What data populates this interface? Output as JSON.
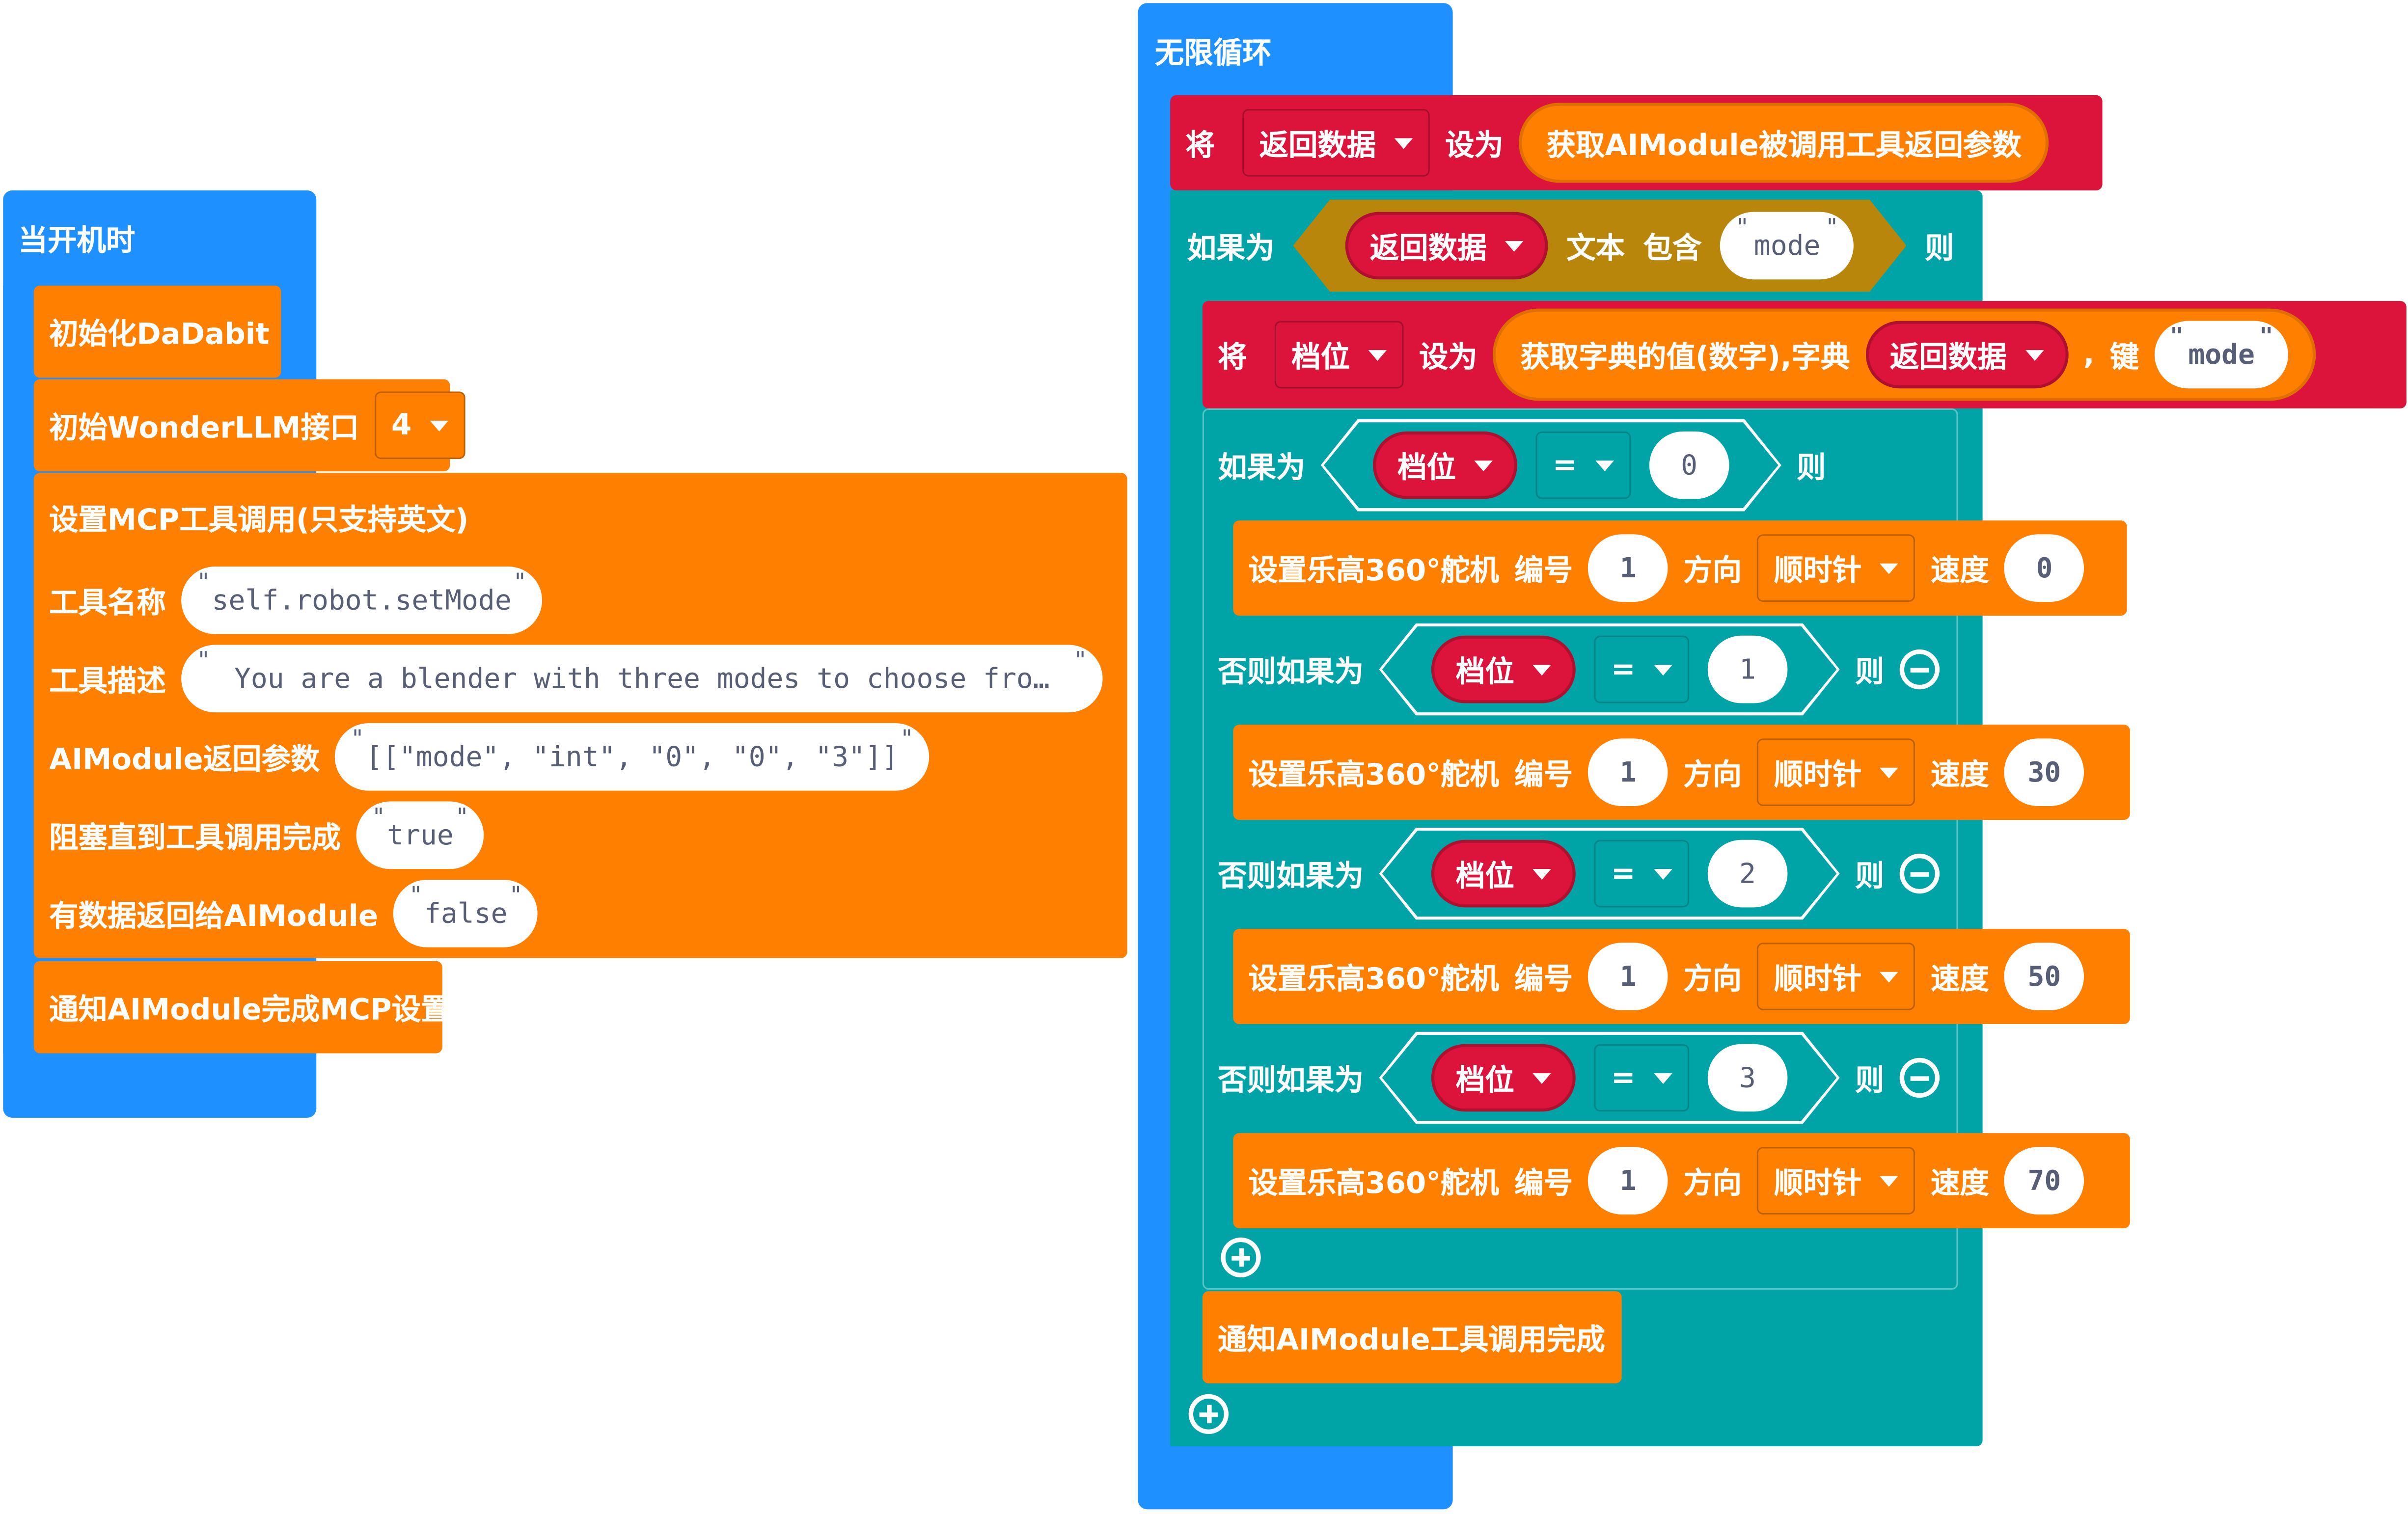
{
  "colors": {
    "event": "#1e90ff",
    "action": "#ff8000",
    "variable": "#dc143c",
    "logic": "#00a4a6",
    "text_check": "#b8860b"
  },
  "startup": {
    "hat": "当开机时",
    "init_dadabit": "初始化DaDabit",
    "init_llm": {
      "label": "初始WonderLLM接口",
      "port": "4"
    },
    "mcp": {
      "header": "设置MCP工具调用(只支持英文)",
      "tool_name_label": "工具名称",
      "tool_name_value": "self.robot.setMode",
      "tool_desc_label": "工具描述",
      "tool_desc_value": "You are a blender with three modes to choose fro…",
      "ret_params_label": "AIModule返回参数",
      "ret_params_value": "[[\"mode\", \"int\", \"0\", \"0\", \"3\"]]",
      "block_label": "阻塞直到工具调用完成",
      "block_value": "true",
      "return_label": "有数据返回给AIModule",
      "return_value": "false"
    },
    "notify_setup": "通知AIModule完成MCP设置"
  },
  "loop": {
    "hat": "无限循环",
    "set1": {
      "prefix": "将",
      "var": "返回数据",
      "as": "设为",
      "value": "获取AIModule被调用工具返回参数"
    },
    "if1": {
      "label": "如果为",
      "var": "返回数据",
      "text": "文本",
      "contains": "包含",
      "str": "mode",
      "then": "则"
    },
    "set2": {
      "prefix": "将",
      "var": "档位",
      "as": "设为",
      "getter": "获取字典的值(数字),字典",
      "dict": "返回数据",
      "comma": ",",
      "key_label": "键",
      "key": "mode"
    },
    "branches": [
      {
        "label": "如果为",
        "var": "档位",
        "op": "=",
        "value": "0",
        "then": "则",
        "servo": {
          "label": "设置乐高360°舵机",
          "id_label": "编号",
          "id": "1",
          "dir_label": "方向",
          "dir": "顺时针",
          "speed_label": "速度",
          "speed": "0"
        }
      },
      {
        "label": "否则如果为",
        "var": "档位",
        "op": "=",
        "value": "1",
        "then": "则",
        "servo": {
          "label": "设置乐高360°舵机",
          "id_label": "编号",
          "id": "1",
          "dir_label": "方向",
          "dir": "顺时针",
          "speed_label": "速度",
          "speed": "30"
        }
      },
      {
        "label": "否则如果为",
        "var": "档位",
        "op": "=",
        "value": "2",
        "then": "则",
        "servo": {
          "label": "设置乐高360°舵机",
          "id_label": "编号",
          "id": "1",
          "dir_label": "方向",
          "dir": "顺时针",
          "speed_label": "速度",
          "speed": "50"
        }
      },
      {
        "label": "否则如果为",
        "var": "档位",
        "op": "=",
        "value": "3",
        "then": "则",
        "servo": {
          "label": "设置乐高360°舵机",
          "id_label": "编号",
          "id": "1",
          "dir_label": "方向",
          "dir": "顺时针",
          "speed_label": "速度",
          "speed": "70"
        }
      }
    ],
    "notify_done": "通知AIModule工具调用完成"
  }
}
